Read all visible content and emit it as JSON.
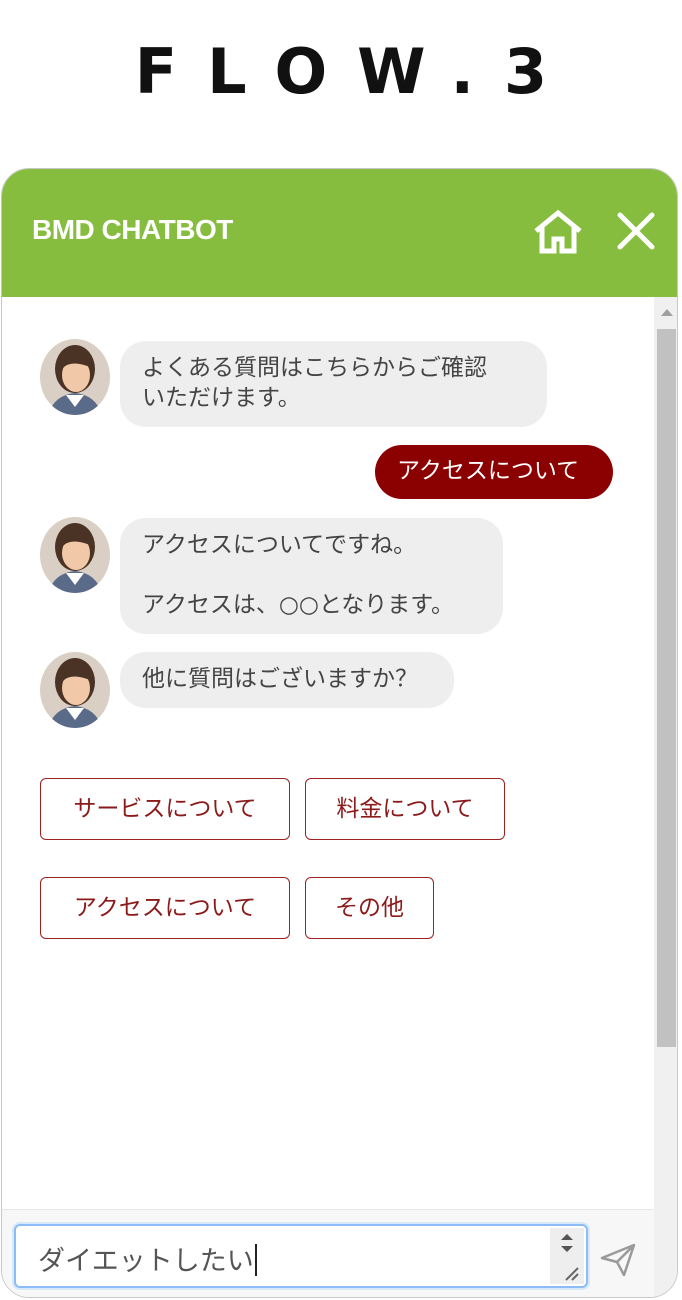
{
  "page_title": "FLOW.3",
  "chatbot": {
    "title": "BMD CHATBOT",
    "home_icon": "home-icon",
    "close_icon": "close-icon",
    "header_color": "#86bd3f",
    "accent_color": "#8b0000"
  },
  "messages": [
    {
      "from": "bot",
      "text": "よくある質問はこちらからご確認\nいただけます。"
    },
    {
      "from": "user",
      "text": "アクセスについて"
    },
    {
      "from": "bot",
      "text": "アクセスについてですね。\n\nアクセスは、○○となります。"
    },
    {
      "from": "bot",
      "text": "他に質問はございますか？"
    }
  ],
  "options": [
    {
      "label": "サービスについて"
    },
    {
      "label": "料金について"
    },
    {
      "label": "アクセスについて"
    },
    {
      "label": "その他"
    }
  ],
  "input": {
    "value": "ダイエットしたい",
    "send_icon": "send-icon"
  }
}
